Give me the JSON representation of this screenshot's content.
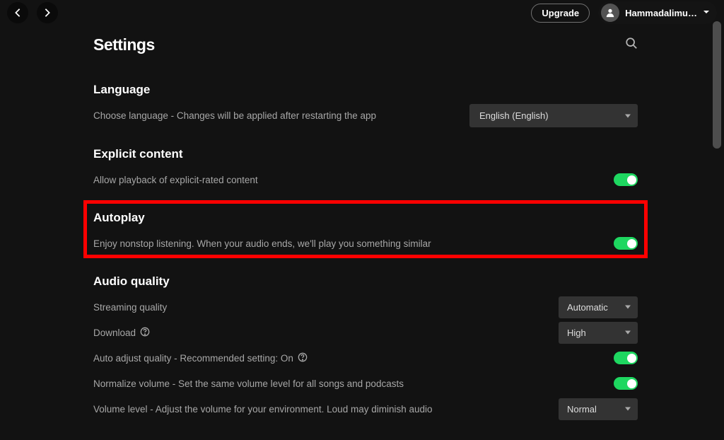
{
  "topbar": {
    "upgrade_label": "Upgrade",
    "profile_name": "Hammadalimu…"
  },
  "page": {
    "title": "Settings"
  },
  "sections": {
    "language": {
      "title": "Language",
      "description": "Choose language - Changes will be applied after restarting the app",
      "selected": "English (English)"
    },
    "explicit": {
      "title": "Explicit content",
      "description": "Allow playback of explicit-rated content",
      "enabled": true
    },
    "autoplay": {
      "title": "Autoplay",
      "description": "Enjoy nonstop listening. When your audio ends, we'll play you something similar",
      "enabled": true
    },
    "audio": {
      "title": "Audio quality",
      "streaming_label": "Streaming quality",
      "streaming_value": "Automatic",
      "download_label": "Download",
      "download_value": "High",
      "auto_adjust_label": "Auto adjust quality - Recommended setting: On",
      "auto_adjust_enabled": true,
      "normalize_label": "Normalize volume - Set the same volume level for all songs and podcasts",
      "normalize_enabled": true,
      "volume_level_label": "Volume level - Adjust the volume for your environment. Loud may diminish audio",
      "volume_level_value": "Normal"
    }
  }
}
